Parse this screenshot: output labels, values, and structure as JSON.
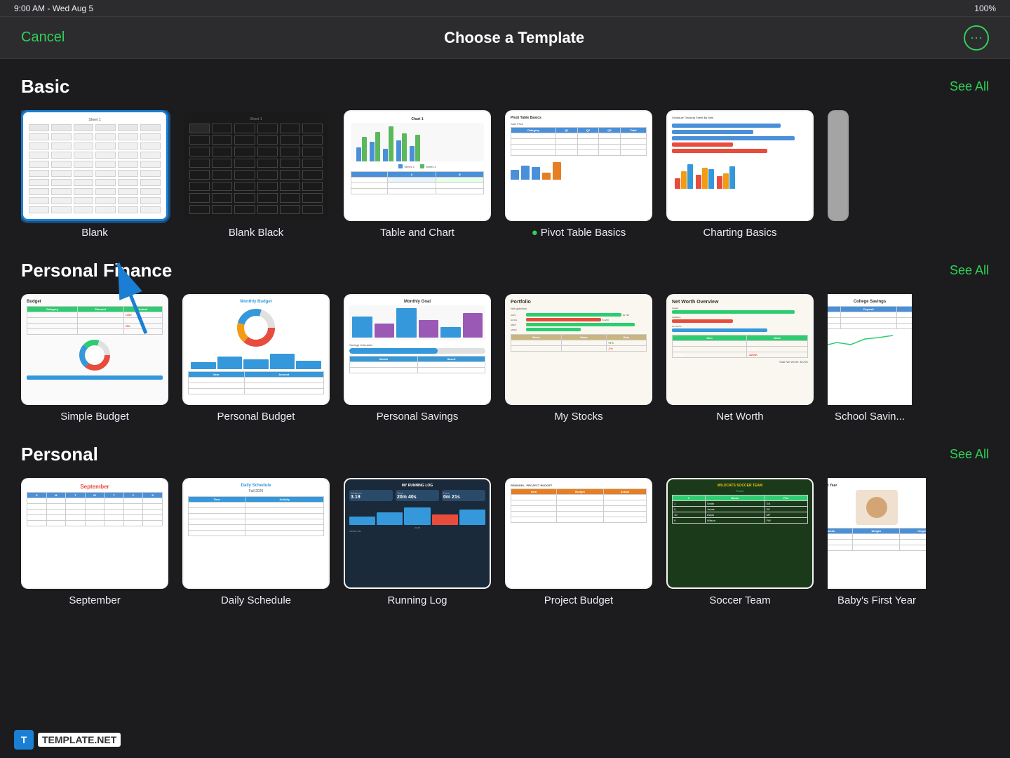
{
  "statusBar": {
    "time": "9:00 AM - Wed Aug 5",
    "battery": "100%"
  },
  "header": {
    "cancelLabel": "Cancel",
    "title": "Choose a Template",
    "moreIcon": "⊕"
  },
  "sections": [
    {
      "id": "basic",
      "title": "Basic",
      "seeAllLabel": "See All",
      "templates": [
        {
          "id": "blank",
          "label": "Blank",
          "selected": true
        },
        {
          "id": "blank-black",
          "label": "Blank Black",
          "selected": false
        },
        {
          "id": "table-and-chart",
          "label": "Table and Chart",
          "selected": false
        },
        {
          "id": "pivot-table-basics",
          "label": "Pivot Table Basics",
          "selected": false,
          "dot": true
        },
        {
          "id": "charting-basics",
          "label": "Charting Basics",
          "selected": false
        }
      ]
    },
    {
      "id": "personal-finance",
      "title": "Personal Finance",
      "seeAllLabel": "See All",
      "templates": [
        {
          "id": "simple-budget",
          "label": "Simple Budget",
          "selected": false
        },
        {
          "id": "personal-budget",
          "label": "Personal Budget",
          "selected": false
        },
        {
          "id": "personal-savings",
          "label": "Personal Savings",
          "selected": false
        },
        {
          "id": "my-stocks",
          "label": "My Stocks",
          "selected": false
        },
        {
          "id": "net-worth",
          "label": "Net Worth",
          "selected": false
        },
        {
          "id": "school-savings",
          "label": "School Savin...",
          "selected": false
        }
      ]
    },
    {
      "id": "personal",
      "title": "Personal",
      "seeAllLabel": "See All",
      "templates": [
        {
          "id": "calendar",
          "label": "September",
          "selected": false
        },
        {
          "id": "daily-schedule",
          "label": "Daily Schedule",
          "selected": false
        },
        {
          "id": "running-log",
          "label": "Running Log",
          "selected": false
        },
        {
          "id": "project-budget",
          "label": "Project Budget",
          "selected": false
        },
        {
          "id": "soccer-team",
          "label": "Soccer Team",
          "selected": false
        },
        {
          "id": "babys-first",
          "label": "Baby's First Year",
          "selected": false
        }
      ]
    }
  ],
  "watermark": {
    "logo": "T",
    "text": "TEMPLATE.NET"
  },
  "arrow": {
    "description": "Blue arrow pointing to Blank template"
  }
}
